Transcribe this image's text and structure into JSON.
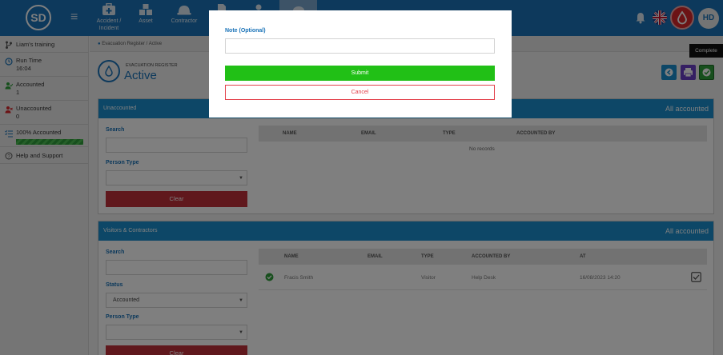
{
  "app": {
    "logo_text": "SD",
    "avatar_initials": "HD"
  },
  "nav": [
    {
      "label": "Accident / Incident",
      "icon": "first-aid-kit-icon"
    },
    {
      "label": "Asset",
      "icon": "boxes-icon"
    },
    {
      "label": "Contractor",
      "icon": "hard-hat-icon"
    },
    {
      "label": "",
      "icon": "document-icon"
    },
    {
      "label": "",
      "icon": "person-icon"
    },
    {
      "label": "",
      "icon": "evacuation-icon",
      "active": true
    }
  ],
  "sidebar": {
    "items": [
      {
        "label": "Liam's training",
        "icon": "branch-icon"
      },
      {
        "label": "Run Time",
        "value": "16:04",
        "icon": "clock-icon"
      },
      {
        "label": "Accounted",
        "value": "1",
        "icon": "user-check-icon"
      },
      {
        "label": "Unaccounted",
        "value": "0",
        "icon": "user-x-icon"
      },
      {
        "label": "100% Accounted",
        "icon": "list-check-icon",
        "progress": 1.0
      },
      {
        "label": "Help and Support",
        "icon": "question-icon"
      }
    ]
  },
  "breadcrumb": {
    "root": "Evacuation Register",
    "current": "Active",
    "separator": "/"
  },
  "header": {
    "subtitle": "EVACUATION REGISTER",
    "title": "Active"
  },
  "tooltip": "Complete",
  "unaccounted": {
    "title": "Unaccounted",
    "status": "All accounted",
    "search_label": "Search",
    "person_type_label": "Person Type",
    "clear_label": "Clear",
    "columns": [
      "NAME",
      "EMAIL",
      "TYPE",
      "ACCOUNTED BY"
    ],
    "empty_text": "No records"
  },
  "visitors": {
    "title": "Visitors & Contractors",
    "status": "All accounted",
    "search_label": "Search",
    "status_label": "Status",
    "status_value": "Accounted",
    "person_type_label": "Person Type",
    "clear_label": "Clear",
    "columns": [
      "NAME",
      "EMAIL",
      "TYPE",
      "ACCOUNTED BY",
      "AT"
    ],
    "rows": [
      {
        "name": "Fracis Smith",
        "email": "",
        "type": "Visitor",
        "accounted_by": "Help Desk",
        "at": "16/08/2023 14:20"
      }
    ]
  },
  "modal": {
    "note_label": "Note (Optional)",
    "note_value": "",
    "submit_label": "Submit",
    "cancel_label": "Cancel"
  },
  "colors": {
    "primary": "#1a73b8",
    "panel_header": "#1a8fcf",
    "submit": "#21c016",
    "cancel": "#e3414b",
    "clear": "#c0303a",
    "alert": "#d8262a"
  }
}
